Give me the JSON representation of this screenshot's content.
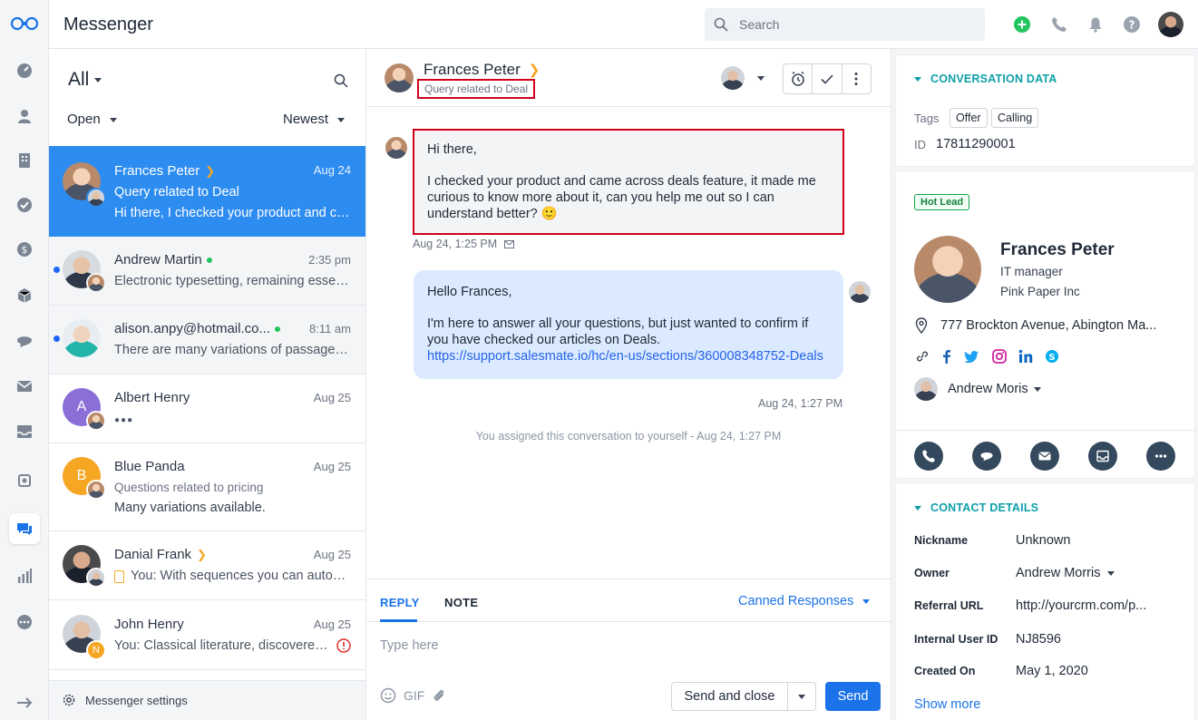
{
  "app": {
    "title": "Messenger"
  },
  "search": {
    "placeholder": "Search"
  },
  "list": {
    "filter": "All",
    "status_filter": "Open",
    "sort": "Newest",
    "footer": "Messenger settings",
    "conversations": [
      {
        "name": "Frances Peter",
        "time": "Aug 24",
        "line2": "Query related to Deal",
        "line3": "Hi there, I checked your product and came across deals feature"
      },
      {
        "name": "Andrew Martin",
        "time": "2:35 pm",
        "line2": "Electronic typesetting, remaining essentially unchanged"
      },
      {
        "name": "alison.anpy@hotmail.co...",
        "time": "8:11 am",
        "line2": "There are many variations of passages of Lorem Ipsum"
      },
      {
        "name": "Albert Henry",
        "time": "Aug 25",
        "initial": "A",
        "line2": "●●●"
      },
      {
        "name": "Blue Panda",
        "time": "Aug 25",
        "initial": "B",
        "line2": "Questions related to pricing",
        "line3": "Many variations available."
      },
      {
        "name": "Danial Frank",
        "time": "Aug 25",
        "line2": "You: With sequences you can automate"
      },
      {
        "name": "John Henry",
        "time": "Aug 25",
        "badge": "N",
        "line2": "You: Classical literature, discovered the undoubtable source"
      }
    ]
  },
  "chat": {
    "contact_name": "Frances Peter",
    "subject": "Query related to Deal",
    "incoming": {
      "greeting": "Hi there,",
      "body": "I checked your product and came across deals feature, it made me curious to know more about it, can you help me out so I can understand better? 🙂",
      "meta": "Aug 24, 1:25 PM"
    },
    "outgoing": {
      "greeting": "Hello Frances,",
      "body": "I'm here to answer all your questions, but just wanted to confirm if you have checked our articles on Deals.",
      "link": "https://support.salesmate.io/hc/en-us/sections/360008348752-Deals",
      "meta": "Aug 24, 1:27 PM"
    },
    "system": "You assigned this conversation to yourself - Aug 24, 1:27 PM",
    "composer": {
      "tab_reply": "REPLY",
      "tab_note": "NOTE",
      "canned": "Canned Responses",
      "placeholder": "Type here",
      "gif": "GIF",
      "send_close": "Send and close",
      "send": "Send"
    }
  },
  "panel": {
    "conversation_data": {
      "title": "CONVERSATION DATA",
      "tags_label": "Tags",
      "tags": [
        "Offer",
        "Calling"
      ],
      "id_label": "ID",
      "id": "17811290001"
    },
    "contact": {
      "badge": "Hot Lead",
      "name": "Frances Peter",
      "role": "IT manager",
      "company": "Pink Paper Inc",
      "address": "777 Brockton Avenue, Abington Ma...",
      "owner": "Andrew Moris"
    },
    "details": {
      "title": "CONTACT DETAILS",
      "rows": [
        {
          "label": "Nickname",
          "value": "Unknown"
        },
        {
          "label": "Owner",
          "value": "Andrew Morris"
        },
        {
          "label": "Referral URL",
          "value": "http://yourcrm.com/p..."
        },
        {
          "label": "Internal User ID",
          "value": "NJ8596"
        },
        {
          "label": "Created On",
          "value": "May 1, 2020"
        }
      ],
      "show_more": "Show more"
    }
  },
  "colors": {
    "accent": "#1a73e8",
    "selected_row": "#2d8cf0",
    "teal": "#0e9fa8",
    "highlight_border": "#d0021b"
  }
}
